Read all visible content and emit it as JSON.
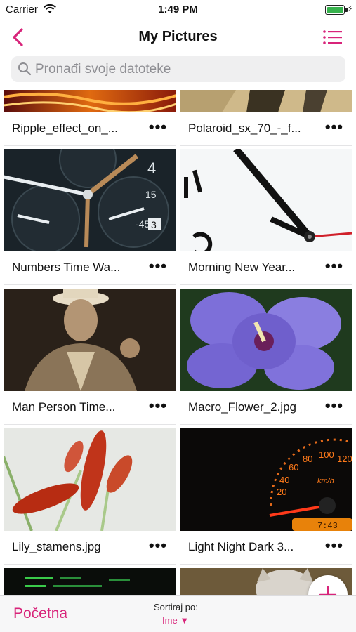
{
  "status_bar": {
    "carrier": "Carrier",
    "time": "1:49 PM"
  },
  "header": {
    "title": "My Pictures"
  },
  "search": {
    "placeholder": "Pronađi svoje datoteke"
  },
  "files": [
    {
      "name": "Ripple_effect_on_...",
      "icon": "more-icon"
    },
    {
      "name": "Polaroid_sx_70_-_f...",
      "icon": "more-icon"
    },
    {
      "name": "Numbers Time Wa...",
      "icon": "more-icon"
    },
    {
      "name": "Morning New Year...",
      "icon": "more-icon"
    },
    {
      "name": "Man Person Time...",
      "icon": "more-icon"
    },
    {
      "name": "Macro_Flower_2.jpg",
      "icon": "more-icon"
    },
    {
      "name": "Lily_stamens.jpg",
      "icon": "more-icon"
    },
    {
      "name": "Light Night Dark 3...",
      "icon": "more-icon"
    }
  ],
  "more_label": "•••",
  "bottom_bar": {
    "home_label": "Početna",
    "sort_label": "Sortiraj po:",
    "sort_value": "Ime ▼"
  },
  "theme": {
    "accent": "#d8247a",
    "search_bg": "#efeff0",
    "bar_bg": "#f7f7f8"
  }
}
